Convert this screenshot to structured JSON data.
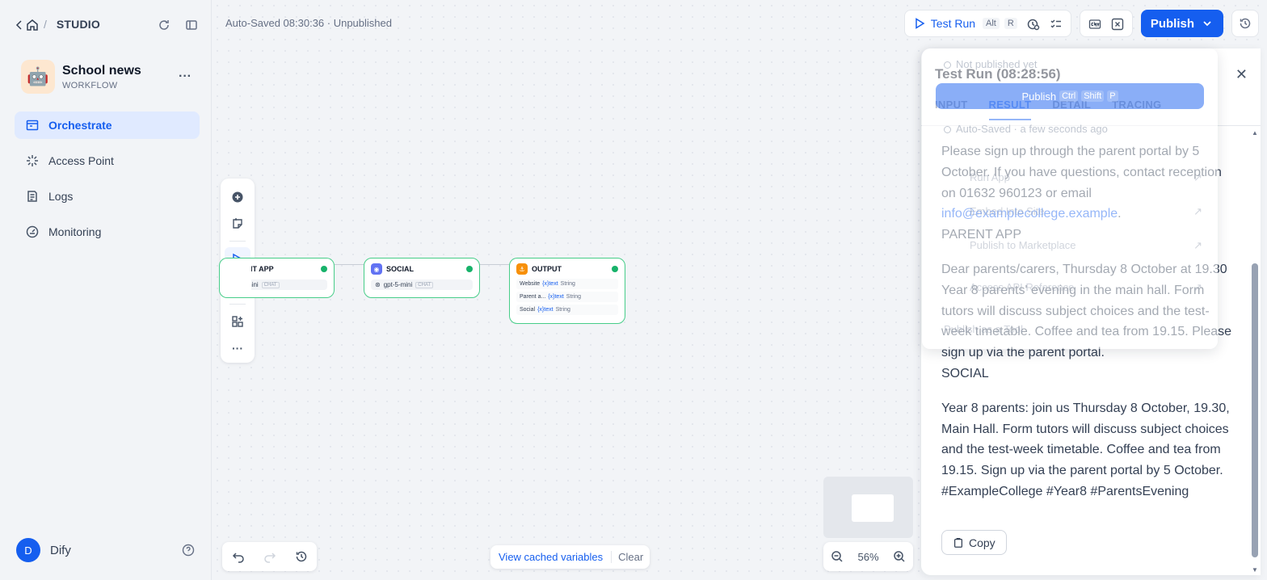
{
  "sidebar": {
    "studio_label": "STUDIO",
    "app": {
      "name": "School news",
      "type": "WORKFLOW",
      "emoji": "🤖"
    },
    "nav": [
      {
        "label": "Orchestrate",
        "icon": "orchestrate-icon",
        "active": true
      },
      {
        "label": "Access Point",
        "icon": "access-point-icon",
        "active": false
      },
      {
        "label": "Logs",
        "icon": "logs-icon",
        "active": false
      },
      {
        "label": "Monitoring",
        "icon": "monitoring-icon",
        "active": false
      }
    ],
    "user": {
      "initial": "D",
      "name": "Dify"
    }
  },
  "header": {
    "autosave": "Auto-Saved 08:30:36 · Unpublished",
    "test_run": "Test Run",
    "test_run_kbd1": "Alt",
    "test_run_kbd2": "R",
    "publish": "Publish"
  },
  "nodes": [
    {
      "title": "ENT APP",
      "model": "mini",
      "tag": "CHAT"
    },
    {
      "title": "SOCIAL",
      "model": "gpt-5-mini",
      "tag": "CHAT"
    },
    {
      "title": "OUTPUT",
      "vars": [
        {
          "name": "Website",
          "var": "text",
          "type": "String"
        },
        {
          "name": "Parent a...",
          "var": "text",
          "type": "String"
        },
        {
          "name": "Social",
          "var": "text",
          "type": "String"
        }
      ]
    }
  ],
  "bottom": {
    "view_cached": "View cached variables",
    "clear": "Clear",
    "zoom": "56%"
  },
  "panel": {
    "title": "Test Run (08:28:56)",
    "tabs": [
      "INPUT",
      "RESULT",
      "DETAIL",
      "TRACING"
    ],
    "result": {
      "p1": "Please sign up through the parent portal by 5 October. If you have questions, contact reception on 01632 960123 or email ",
      "email": "info@examplecollege.example",
      "p1_end": ".",
      "h_parent": "PARENT APP",
      "p2": "Dear parents/carers, Thursday 8 October at 19.30 Year 8 parents' evening in the main hall. Form tutors will discuss subject choices and the test-week timetable. Coffee and tea from 19.15. Please sign up via the parent portal.",
      "h_social": "SOCIAL",
      "p3": "Year 8 parents: join us Thursday 8 October, 19.30, Main Hall. Form tutors will discuss subject choices and the test-week timetable. Coffee and tea from 19.15. Sign up via the parent portal by 5 October. #ExampleCollege #Year8 #ParentsEvening"
    },
    "copy": "Copy"
  },
  "publish_menu": {
    "not_published": "Not published yet",
    "publish": "Publish",
    "kbd1": "Ctrl",
    "kbd2": "Shift",
    "kbd3": "P",
    "autosaved": "Auto-Saved · a few seconds ago",
    "item_run": "Run App",
    "item_embed": "Embed Into Site",
    "item_marketplace": "Publish to Marketplace",
    "item_api": "Access API Reference",
    "item_tool": "Publish as a Tool"
  },
  "colors": {
    "accent": "#155eef",
    "node_border": "#47cd89",
    "success": "#17b26a"
  }
}
